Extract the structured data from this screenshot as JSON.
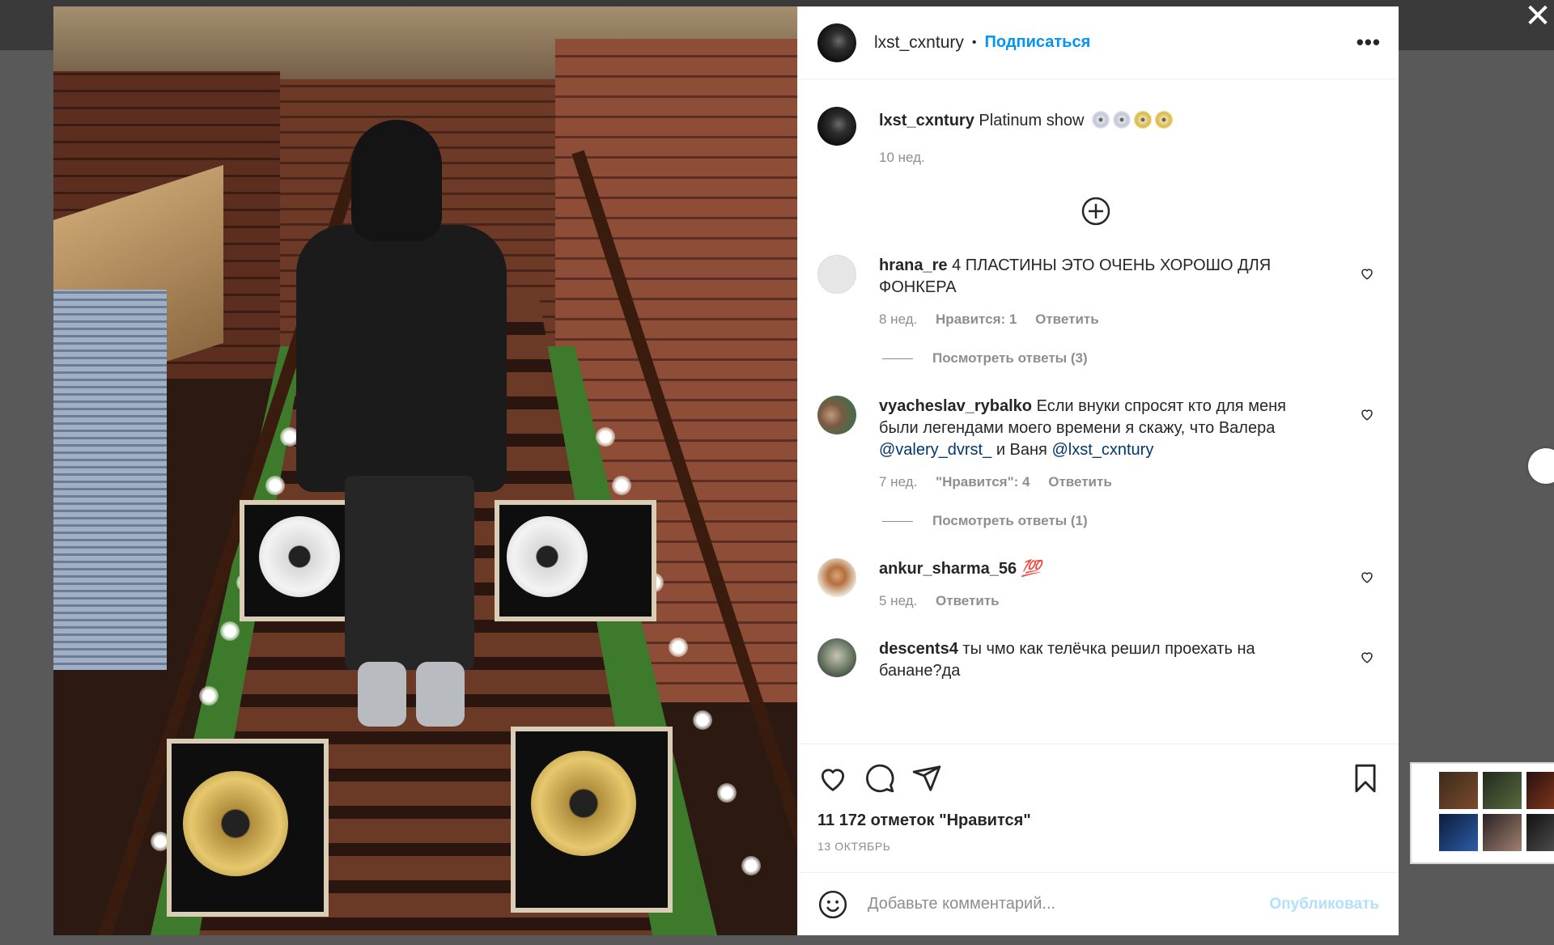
{
  "post": {
    "author": "lxst_cxntury",
    "follow_label": "Подписаться",
    "more_label": "•••",
    "caption_user": "lxst_cxntury",
    "caption_text": "Platinum show",
    "caption_time": "10 нед."
  },
  "comments": [
    {
      "user": "hrana_re",
      "text": "4 ПЛАСТИНЫ ЭТО ОЧЕНЬ ХОРОШО ДЛЯ ФОНКЕРА",
      "time": "8 нед.",
      "likes": "Нравится: 1",
      "reply": "Ответить",
      "view_replies": "Посмотреть ответы (3)"
    },
    {
      "user": "vyacheslav_rybalko",
      "text_before": "Если внуки спросят кто для меня были легендами моего времени я скажу, что Валера",
      "mention1": "@valery_dvrst_",
      "text_mid": "и Ваня",
      "mention2": "@lxst_cxntury",
      "time": "7 нед.",
      "likes": "\"Нравится\": 4",
      "reply": "Ответить",
      "view_replies": "Посмотреть ответы (1)"
    },
    {
      "user": "ankur_sharma_56",
      "text": "💯",
      "time": "5 нед.",
      "reply": "Ответить"
    },
    {
      "user": "descents4",
      "text": "ты чмо как телёчка решил проехать на банане?да"
    }
  ],
  "footer": {
    "likes_count": "11 172 отметок \"Нравится\"",
    "date": "13 ОКТЯБРЬ",
    "comment_placeholder": "Добавьте комментарий...",
    "publish_label": "Опубликовать"
  },
  "window": {
    "close_label": "✕"
  },
  "colors": {
    "accent": "#0095f6",
    "publish_disabled": "#b2dffc",
    "mention": "#00376b",
    "muted": "#8e8e8e"
  }
}
